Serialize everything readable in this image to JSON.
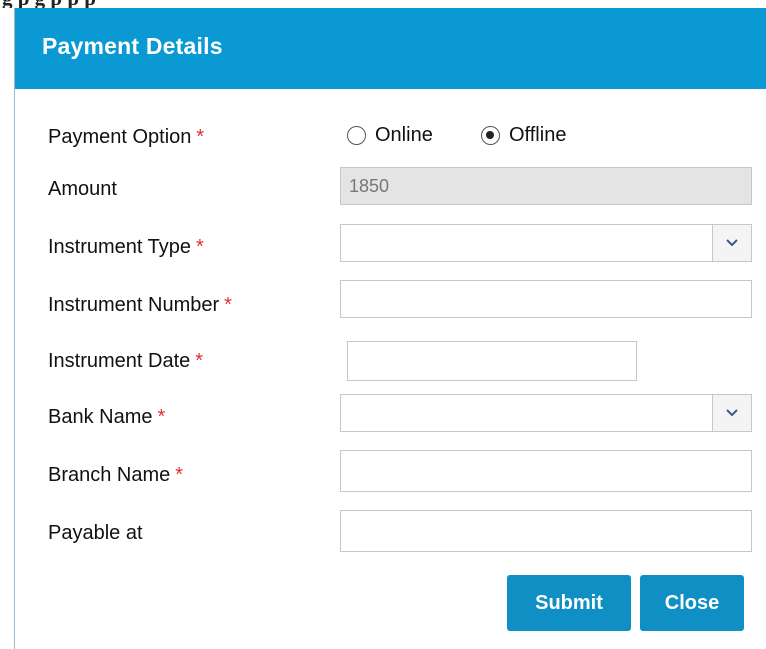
{
  "caption": "g                                            p                                  g p p   p",
  "dialog": {
    "title": "Payment Details",
    "header_color": "#0a99d3"
  },
  "form": {
    "required_marker": "*",
    "payment_option": {
      "label": "Payment Option",
      "options": [
        "Online",
        "Offline"
      ],
      "selected": "Offline"
    },
    "amount": {
      "label": "Amount",
      "value": "1850"
    },
    "instrument_type": {
      "label": "Instrument Type",
      "value": ""
    },
    "instrument_number": {
      "label": "Instrument Number",
      "value": ""
    },
    "instrument_date": {
      "label": "Instrument Date",
      "value": ""
    },
    "bank_name": {
      "label": "Bank Name",
      "value": ""
    },
    "branch_name": {
      "label": "Branch Name",
      "value": ""
    },
    "payable_at": {
      "label": "Payable at",
      "value": ""
    }
  },
  "actions": {
    "submit_label": "Submit",
    "close_label": "Close",
    "button_color": "#0f8fc4"
  },
  "icons": {
    "dropdown": "chevron-down-icon"
  }
}
